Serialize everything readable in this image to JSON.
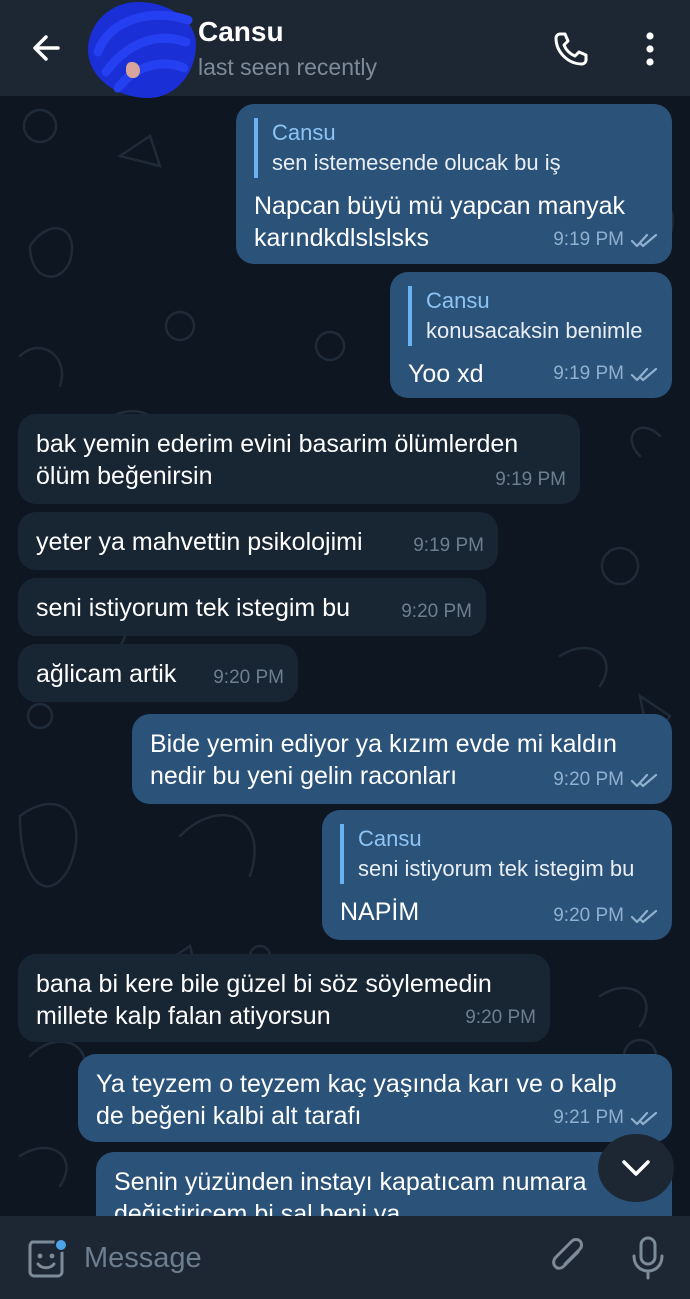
{
  "header": {
    "back_icon": "arrow-left-icon",
    "contact_name": "Cansu",
    "status": "last seen recently",
    "call_icon": "phone-icon",
    "menu_icon": "more-vertical-icon"
  },
  "messages": [
    {
      "direction": "out",
      "reply_name": "Cansu",
      "reply_text": "sen istemesende olucak bu iş",
      "text": "Napcan büyü mü yapcan manyak\nkarındkdlslslsks",
      "time": "9:19 PM",
      "read": true
    },
    {
      "direction": "out",
      "reply_name": "Cansu",
      "reply_text": "konusacaksin benimle",
      "text": "Yoo xd",
      "time": "9:19 PM",
      "read": true
    },
    {
      "direction": "in",
      "text": "bak yemin ederim evini basarim ölümlerden\nölüm beğenirsin",
      "time": "9:19 PM"
    },
    {
      "direction": "in",
      "text": "yeter ya mahvettin psikolojimi",
      "time": "9:19 PM"
    },
    {
      "direction": "in",
      "text": "seni istiyorum tek istegim bu",
      "time": "9:20 PM"
    },
    {
      "direction": "in",
      "text": "ağlicam artik",
      "time": "9:20 PM"
    },
    {
      "direction": "out",
      "text": "Bide yemin ediyor ya kızım evde mi kaldın\nnedir bu yeni gelin raconları",
      "time": "9:20 PM",
      "read": true
    },
    {
      "direction": "out",
      "reply_name": "Cansu",
      "reply_text": "seni istiyorum tek istegim bu",
      "text": "NAPİM",
      "time": "9:20 PM",
      "read": true
    },
    {
      "direction": "in",
      "text": "bana bi kere bile güzel bi söz söylemedin\nmillete kalp falan atiyorsun",
      "time": "9:20 PM"
    },
    {
      "direction": "out",
      "text": "Ya teyzem o teyzem kaç yaşında karı ve o kalp\nde beğeni kalbi alt tarafı",
      "time": "9:21 PM",
      "read": true
    },
    {
      "direction": "out",
      "text": "Senin yüzünden instayı kapatıcam numara\ndeğiştiricem bi sal beni ya",
      "time": "",
      "read": false
    }
  ],
  "scroll_down_icon": "chevron-down-icon",
  "composer": {
    "emoji_icon": "sticker-icon",
    "placeholder": "Message",
    "attach_icon": "paperclip-icon",
    "mic_icon": "microphone-icon"
  },
  "colors": {
    "background": "#0e1621",
    "header": "#1d2733",
    "outgoing_bubble": "#2b5278",
    "incoming_bubble": "#182533",
    "accent": "#6ab3f3"
  }
}
